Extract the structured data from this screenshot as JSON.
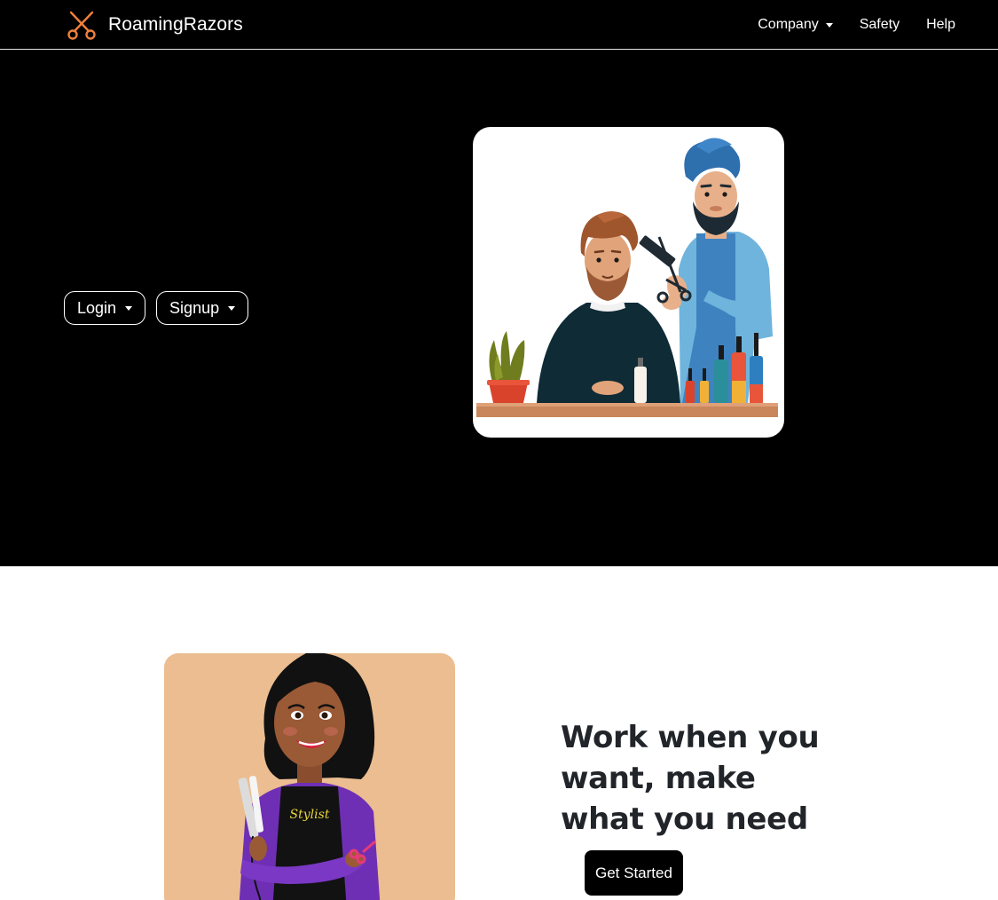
{
  "navbar": {
    "brand_name": "RoamingRazors",
    "brand_icon": "scissors-icon",
    "links": {
      "company": "Company",
      "safety": "Safety",
      "help": "Help"
    }
  },
  "hero": {
    "login_label": "Login",
    "signup_label": "Signup",
    "illustration": "barber-shop-illustration"
  },
  "feature": {
    "illustration": "stylist-illustration",
    "apron_text": "Stylist",
    "headline": "Work when you want, make what you need",
    "cta_label": "Get Started"
  },
  "colors": {
    "accent": "#f0803c",
    "nav_background": "#000000",
    "hero_background": "#000000",
    "stylist_card_background": "#ebbd90"
  }
}
